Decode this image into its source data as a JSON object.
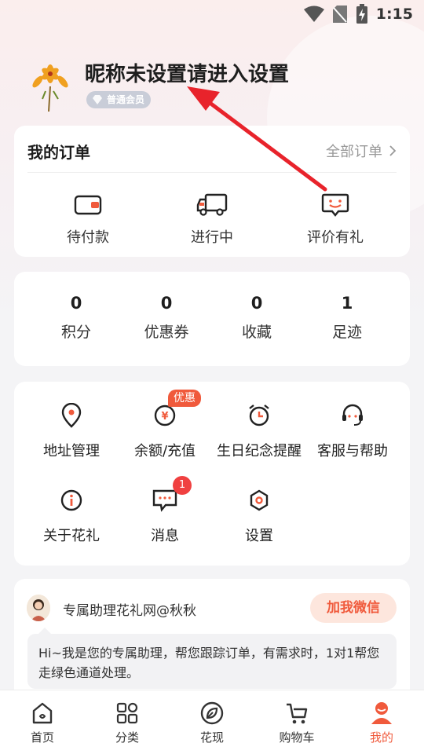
{
  "status_bar": {
    "time": "1:15"
  },
  "profile": {
    "nickname": "昵称未设置请进入设置",
    "member_level": "普通会员"
  },
  "orders": {
    "title": "我的订单",
    "all_label": "全部订单",
    "items": [
      {
        "label": "待付款",
        "icon": "wallet-icon"
      },
      {
        "label": "进行中",
        "icon": "truck-icon"
      },
      {
        "label": "评价有礼",
        "icon": "review-smile-icon"
      }
    ]
  },
  "stats": [
    {
      "value": "0",
      "label": "积分"
    },
    {
      "value": "0",
      "label": "优惠券"
    },
    {
      "value": "0",
      "label": "收藏"
    },
    {
      "value": "1",
      "label": "足迹"
    }
  ],
  "services": {
    "items": [
      {
        "label": "地址管理",
        "icon": "location-icon"
      },
      {
        "label": "余额/充值",
        "icon": "yuan-coin-icon",
        "badge": "优惠"
      },
      {
        "label": "生日纪念提醒",
        "icon": "alarm-clock-icon"
      },
      {
        "label": "客服与帮助",
        "icon": "headset-icon"
      },
      {
        "label": "关于花礼",
        "icon": "info-icon"
      },
      {
        "label": "消息",
        "icon": "message-icon",
        "badge": "1"
      },
      {
        "label": "设置",
        "icon": "settings-icon"
      }
    ]
  },
  "assistant": {
    "name": "专属助理花礼网@秋秋",
    "button": "加我微信",
    "message": "Hi~我是您的专属助理，帮您跟踪订单，有需求时，1对1帮您走绿色通道处理。"
  },
  "tabbar": {
    "items": [
      {
        "label": "首页",
        "icon": "home-icon"
      },
      {
        "label": "分类",
        "icon": "category-icon"
      },
      {
        "label": "花现",
        "icon": "discover-icon"
      },
      {
        "label": "购物车",
        "icon": "cart-icon"
      },
      {
        "label": "我的",
        "icon": "profile-icon",
        "active": true
      }
    ]
  },
  "colors": {
    "accent": "#f05a3c",
    "annotation_arrow": "#e8232b"
  }
}
